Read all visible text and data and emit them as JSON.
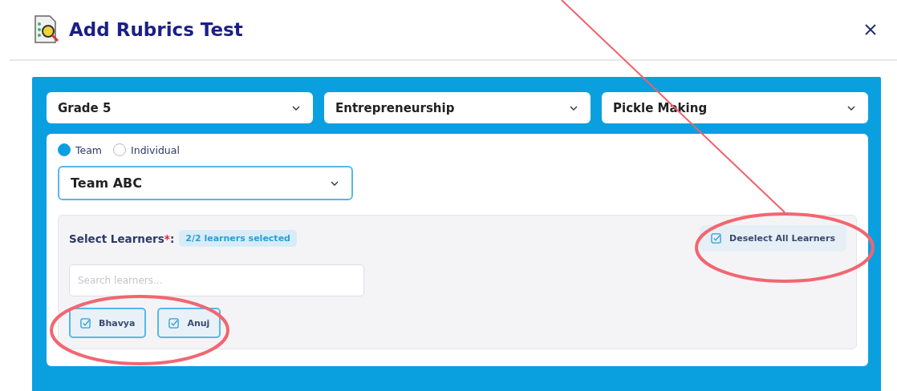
{
  "dialog": {
    "title": "Add Rubrics Test"
  },
  "filters": [
    {
      "value": "Grade 5"
    },
    {
      "value": "Entrepreneurship"
    },
    {
      "value": "Pickle Making"
    }
  ],
  "mode_options": [
    {
      "label": "Team",
      "selected": true
    },
    {
      "label": "Individual",
      "selected": false
    }
  ],
  "team_select": {
    "value": "Team ABC"
  },
  "learners": {
    "label": "Select Learners",
    "required_mark": "*",
    "colon": ":",
    "count_badge": "2/2 learners selected",
    "deselect_button": "Deselect All Learners",
    "search": {
      "placeholder": "Search learners..."
    },
    "items": [
      {
        "name": "Bhavya",
        "checked": true
      },
      {
        "name": "Anuj",
        "checked": true
      }
    ]
  }
}
